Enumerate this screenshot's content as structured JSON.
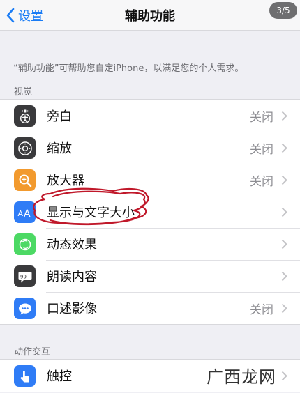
{
  "navbar": {
    "back_label": "设置",
    "title": "辅助功能",
    "counter": "3/5"
  },
  "description": "“辅助功能”可帮助您自定iPhone，以满足您的个人需求。",
  "sections": [
    {
      "header": "视觉",
      "items": [
        {
          "label": "旁白",
          "value": "关闭",
          "icon": "voiceover-icon",
          "color": "#3a3a3c"
        },
        {
          "label": "缩放",
          "value": "关闭",
          "icon": "zoom-icon",
          "color": "#3a3a3c"
        },
        {
          "label": "放大器",
          "value": "关闭",
          "icon": "magnifier-icon",
          "color": "#f29a2e"
        },
        {
          "label": "显示与文字大小",
          "value": "",
          "icon": "text-size-icon",
          "color": "#2f7cf6"
        },
        {
          "label": "动态效果",
          "value": "",
          "icon": "motion-icon",
          "color": "#4cd964"
        },
        {
          "label": "朗读内容",
          "value": "",
          "icon": "spoken-content-icon",
          "color": "#3a3a3c"
        },
        {
          "label": "口述影像",
          "value": "关闭",
          "icon": "audio-description-icon",
          "color": "#2f7cf6"
        }
      ]
    },
    {
      "header": "动作交互",
      "items": [
        {
          "label": "触控",
          "value": "",
          "icon": "touch-icon",
          "color": "#2f7cf6"
        }
      ]
    }
  ],
  "watermark": "广西龙网",
  "colors": {
    "accent": "#1a7cf5",
    "annotation": "#c0182a",
    "background": "#efeff4"
  }
}
